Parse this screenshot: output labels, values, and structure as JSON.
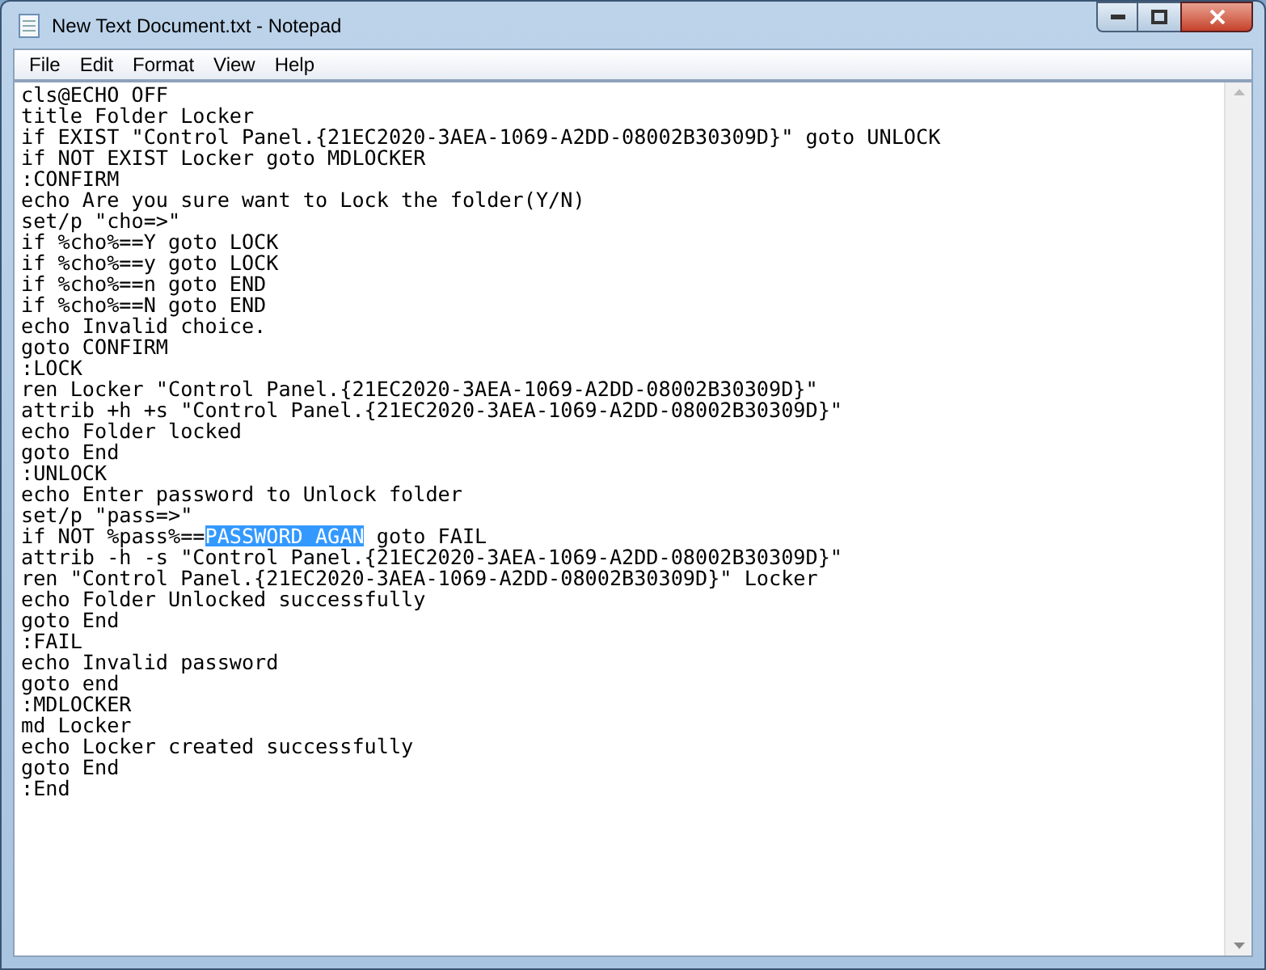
{
  "window": {
    "title": "New Text Document.txt - Notepad"
  },
  "menu": [
    "File",
    "Edit",
    "Format",
    "View",
    "Help"
  ],
  "editor": {
    "lines": [
      "cls@ECHO OFF",
      "title Folder Locker",
      "if EXIST \"Control Panel.{21EC2020-3AEA-1069-A2DD-08002B30309D}\" goto UNLOCK",
      "if NOT EXIST Locker goto MDLOCKER",
      ":CONFIRM",
      "echo Are you sure want to Lock the folder(Y/N)",
      "set/p \"cho=>\"",
      "if %cho%==Y goto LOCK",
      "if %cho%==y goto LOCK",
      "if %cho%==n goto END",
      "if %cho%==N goto END",
      "echo Invalid choice.",
      "goto CONFIRM",
      ":LOCK",
      "ren Locker \"Control Panel.{21EC2020-3AEA-1069-A2DD-08002B30309D}\"",
      "attrib +h +s \"Control Panel.{21EC2020-3AEA-1069-A2DD-08002B30309D}\"",
      "echo Folder locked",
      "goto End",
      ":UNLOCK",
      "echo Enter password to Unlock folder",
      "set/p \"pass=>\"",
      {
        "parts": [
          {
            "text": "if NOT %pass%==",
            "selected": false
          },
          {
            "text": "PASSWORD AGAN",
            "selected": true
          },
          {
            "text": " goto FAIL",
            "selected": false
          }
        ]
      },
      "attrib -h -s \"Control Panel.{21EC2020-3AEA-1069-A2DD-08002B30309D}\"",
      "ren \"Control Panel.{21EC2020-3AEA-1069-A2DD-08002B30309D}\" Locker",
      "echo Folder Unlocked successfully",
      "goto End",
      ":FAIL",
      "echo Invalid password",
      "goto end",
      ":MDLOCKER",
      "md Locker",
      "echo Locker created successfully",
      "goto End",
      ":End"
    ]
  }
}
